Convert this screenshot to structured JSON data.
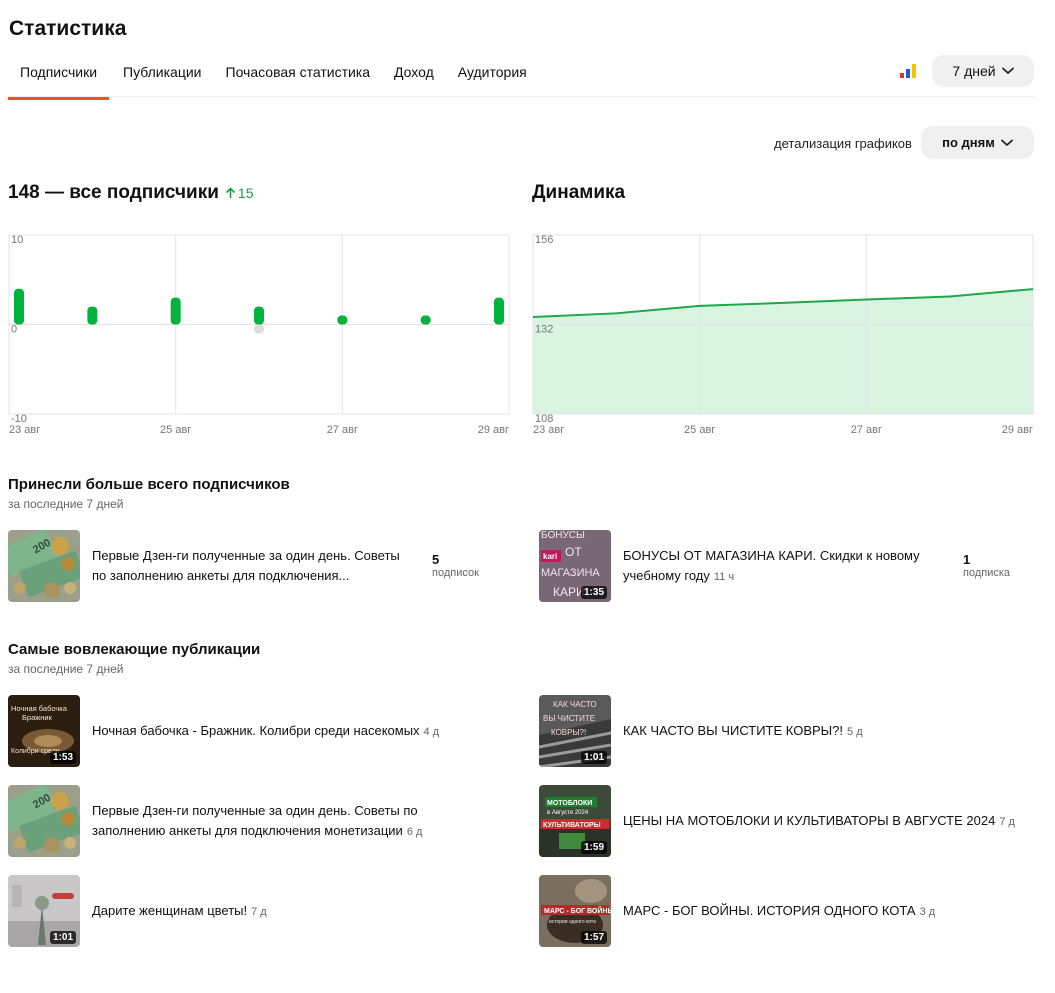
{
  "page": {
    "title": "Статистика"
  },
  "tabs": [
    {
      "label": "Подписчики"
    },
    {
      "label": "Публикации"
    },
    {
      "label": "Почасовая статистика"
    },
    {
      "label": "Доход"
    },
    {
      "label": "Аудитория"
    }
  ],
  "period": {
    "label": "7 дней"
  },
  "detail": {
    "label": "детализация графиков",
    "value": "по дням"
  },
  "subscribers": {
    "total_text": "148 — все подписчики",
    "growth": "15"
  },
  "dynamics": {
    "title": "Динамика"
  },
  "chart_data": [
    {
      "type": "bar",
      "categories": [
        "23 авг",
        "24 авг",
        "25 авг",
        "26 авг",
        "27 авг",
        "28 авг",
        "29 авг"
      ],
      "tick_labels": [
        "23 авг",
        "25 авг",
        "27 авг",
        "29 авг"
      ],
      "y_tick_labels": [
        "10",
        "0",
        "-10"
      ],
      "series": [
        {
          "values": [
            4,
            2,
            3,
            2,
            1,
            1,
            3
          ],
          "color": "#00b33c"
        },
        {
          "values": [
            0,
            0,
            0,
            -1,
            0,
            0,
            0
          ],
          "color": "#dddddd"
        }
      ],
      "ylim": [
        -10,
        10
      ],
      "grid": true
    },
    {
      "type": "area",
      "categories": [
        "23 авг",
        "24 авг",
        "25 авг",
        "26 авг",
        "27 авг",
        "28 авг",
        "29 авг"
      ],
      "tick_labels": [
        "23 авг",
        "25 авг",
        "27 авг",
        "29 авг"
      ],
      "y_tick_labels": [
        "156",
        "132",
        "108"
      ],
      "series": [
        {
          "values": [
            134,
            135,
            137,
            137.8,
            138.7,
            139.5,
            141.5
          ],
          "color": "#1fa84a",
          "fill": "#d9f4e0"
        }
      ],
      "ylim": [
        108,
        156
      ],
      "grid": true
    }
  ],
  "top_sources": {
    "title": "Принесли больше всего подписчиков",
    "subtitle": "за последние 7 дней",
    "items": [
      {
        "title_line1": "Первые Дзен-ги полученные за один день. Советы",
        "title_line2": "по заполнению анкеты для подключения...",
        "count": "5",
        "count_label": "подписок"
      },
      {
        "title_line1": "БОНУСЫ ОТ МАГАЗИНА КАРИ. Скидки к новому",
        "title_line2": "учебному году",
        "ago": "11 ч",
        "duration": "1:35",
        "count": "1",
        "count_label": "подписка"
      }
    ]
  },
  "engaging": {
    "title": "Самые вовлекающие публикации",
    "subtitle": "за последние 7 дней",
    "items": [
      {
        "title": "Ночная бабочка - Бражник. Колибри среди насекомых",
        "ago": "4 д",
        "duration": "1:53"
      },
      {
        "title": "КАК ЧАСТО ВЫ ЧИСТИТЕ КОВРЫ?!",
        "ago": "5 д",
        "duration": "1:01"
      },
      {
        "title_line1": "Первые Дзен-ги полученные за один день. Советы по",
        "title_line2": "заполнению анкеты для подключения монетизации",
        "ago": "6 д"
      },
      {
        "title": "ЦЕНЫ НА МОТОБЛОКИ И КУЛЬТИВАТОРЫ В АВГУСТЕ 2024",
        "ago": "7 д",
        "duration": "1:59"
      },
      {
        "title": "Дарите женщинам цветы!",
        "ago": "7 д",
        "duration": "1:01"
      },
      {
        "title": "МАРС - БОГ ВОЙНЫ. ИСТОРИЯ ОДНОГО КОТА",
        "ago": "3 д",
        "duration": "1:57"
      }
    ]
  },
  "thumb_texts": {
    "money": "200",
    "kari": [
      "БОНУСЫ",
      "ОТ",
      "МАГАЗИНА",
      "КАРИ"
    ],
    "kari_logo": "kari",
    "moth": [
      "Ночная бабочка",
      "Бражник",
      "Колибри среди"
    ],
    "carpet": [
      "КАК ЧАСТО",
      "ВЫ ЧИСТИТЕ",
      "КОВРЫ?!"
    ],
    "moto": [
      "МОТОБЛОКИ",
      "в Августе 2024",
      "КУЛЬТИВАТОРЫ"
    ],
    "mars": [
      "МАРС - БОГ ВОЙНЫ",
      "история одного кота"
    ]
  },
  "colors": {
    "accent": "#e8552b",
    "positive": "#1a9d3c",
    "bar": "#00b33c"
  }
}
